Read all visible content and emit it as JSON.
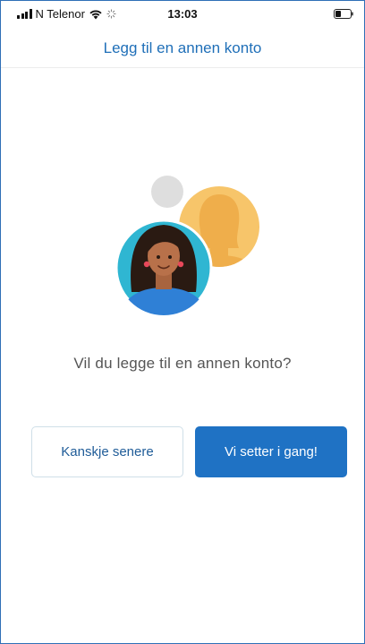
{
  "status_bar": {
    "carrier": "N Telenor",
    "time": "13:03"
  },
  "nav": {
    "title": "Legg til en annen konto"
  },
  "main": {
    "question": "Vil du legge til en annen konto?",
    "later_button": "Kanskje senere",
    "start_button": "Vi setter i gang!"
  },
  "colors": {
    "accent": "#1f72c4",
    "title_blue": "#1f6fb8",
    "avatar_bg_blue": "#2fb6d2",
    "avatar_bg_orange": "#f7c56a"
  },
  "icons": [
    "signal-icon",
    "wifi-icon",
    "loading-icon",
    "battery-icon"
  ]
}
